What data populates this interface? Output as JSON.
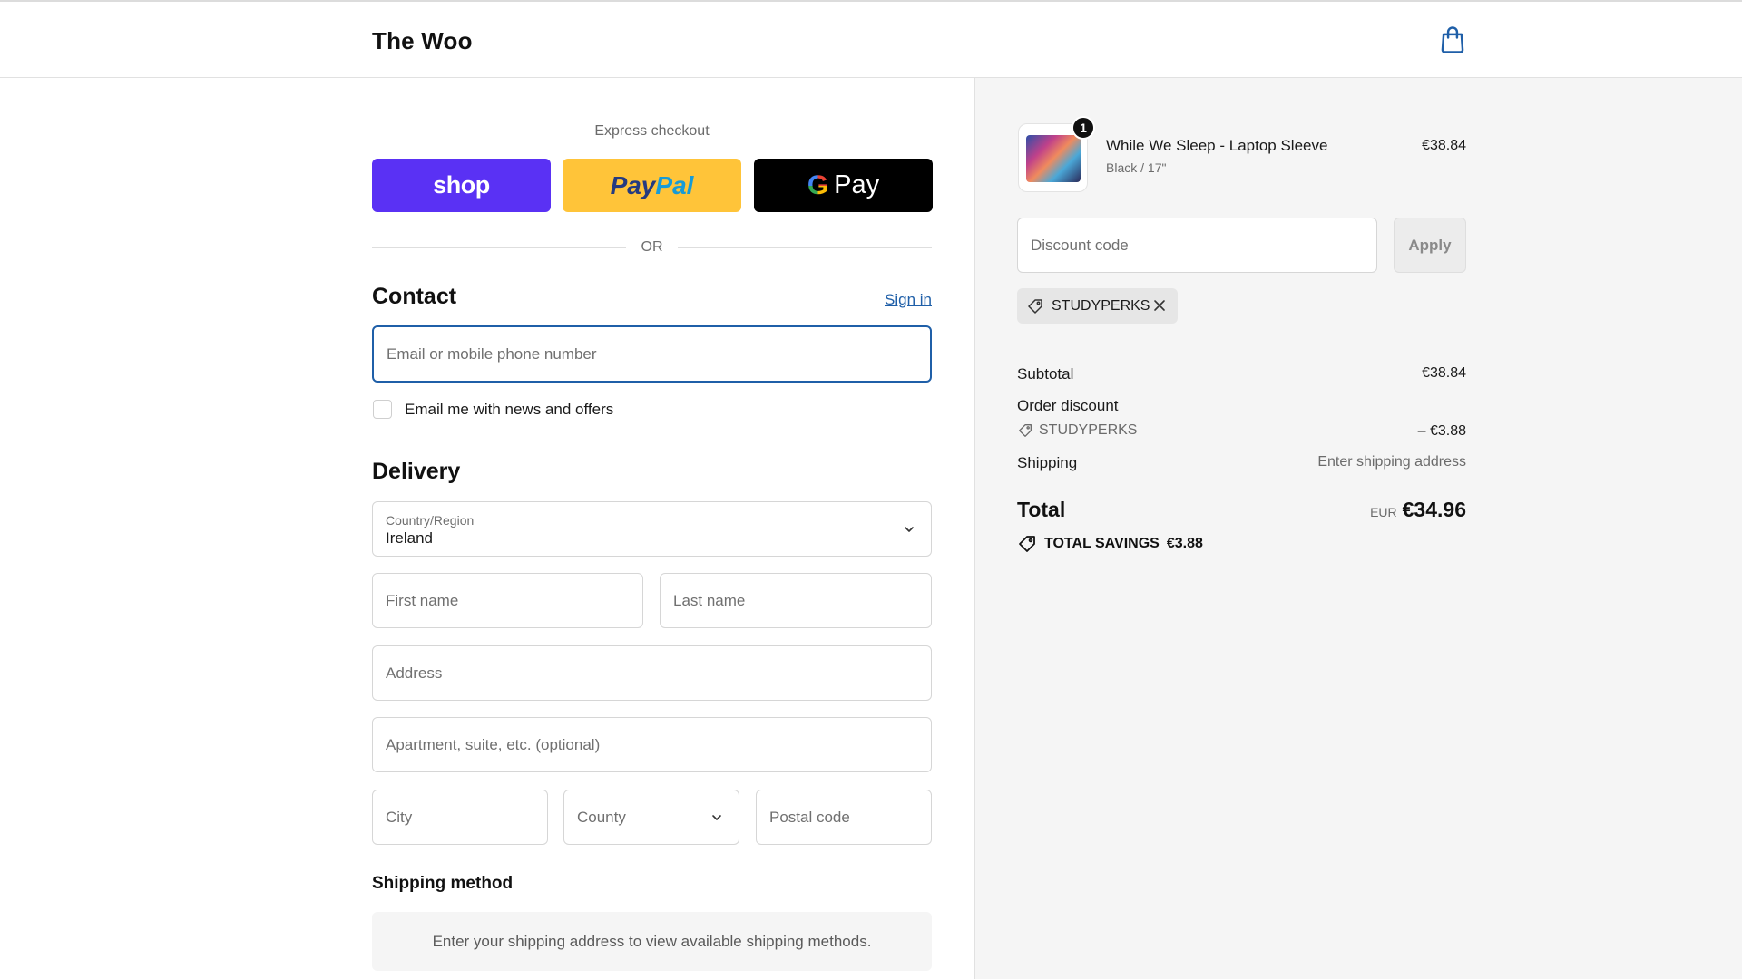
{
  "header": {
    "brand": "The Woo",
    "cart_icon": "shopping-bag-icon"
  },
  "express": {
    "title": "Express checkout",
    "shop_label": "shop",
    "paypal_part1": "Pay",
    "paypal_part2": "Pal",
    "gpay_g": "G",
    "gpay_label": "Pay",
    "or": "OR"
  },
  "contact": {
    "title": "Contact",
    "signin": "Sign in",
    "email_placeholder": "Email or mobile phone number",
    "newsletter_label": "Email me with news and offers",
    "newsletter_checked": false
  },
  "delivery": {
    "title": "Delivery",
    "country_label": "Country/Region",
    "country_value": "Ireland",
    "first_name": "First name",
    "last_name": "Last name",
    "address": "Address",
    "apartment": "Apartment, suite, etc. (optional)",
    "city": "City",
    "county": "County",
    "postal": "Postal code"
  },
  "shipping_method": {
    "title": "Shipping method",
    "message": "Enter your shipping address to view available shipping methods."
  },
  "summary": {
    "item": {
      "quantity": "1",
      "name": "While We Sleep - Laptop Sleeve",
      "variant": "Black / 17\"",
      "price": "€38.84"
    },
    "discount_placeholder": "Discount code",
    "apply_label": "Apply",
    "applied_code": "STUDYPERKS",
    "subtotal_label": "Subtotal",
    "subtotal_value": "€38.84",
    "order_discount_label": "Order discount",
    "order_discount_code": "STUDYPERKS",
    "order_discount_value": "– €3.88",
    "shipping_label": "Shipping",
    "shipping_value": "Enter shipping address",
    "total_label": "Total",
    "total_currency": "EUR",
    "total_value": "€34.96",
    "savings_label": "TOTAL SAVINGS",
    "savings_value": "€3.88"
  },
  "colors": {
    "accent": "#1f5fa8",
    "shop_pay": "#5a31f4",
    "paypal": "#ffc439",
    "gpay": "#000000",
    "summary_bg": "#f5f5f5"
  }
}
